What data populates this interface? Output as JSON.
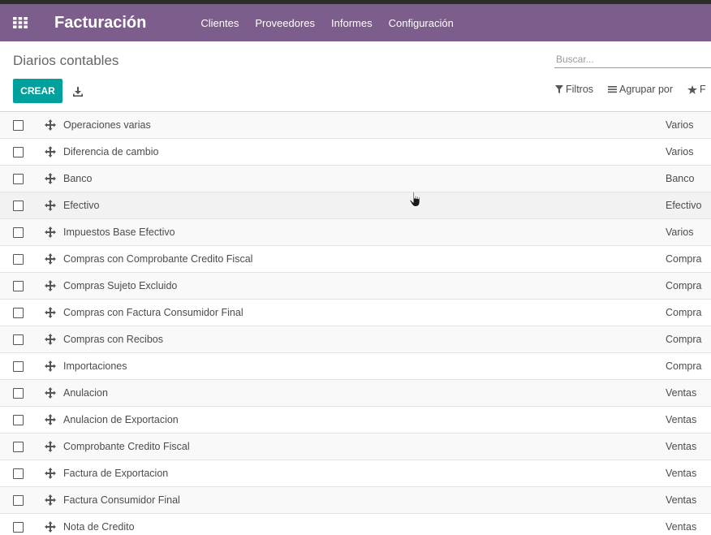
{
  "app": {
    "title": "Facturación",
    "menu": [
      "Clientes",
      "Proveedores",
      "Informes",
      "Configuración"
    ]
  },
  "control_panel": {
    "breadcrumb": "Diarios contables",
    "search_placeholder": "Buscar...",
    "create_label": "CREAR",
    "filters_label": "Filtros",
    "group_by_label": "Agrupar por",
    "favorites_label": "F"
  },
  "colors": {
    "navbar": "#7c5d8c",
    "primary_button": "#00a09d"
  },
  "journals": [
    {
      "name": "Operaciones varias",
      "type": "Varios"
    },
    {
      "name": "Diferencia de cambio",
      "type": "Varios"
    },
    {
      "name": "Banco",
      "type": "Banco"
    },
    {
      "name": "Efectivo",
      "type": "Efectivo"
    },
    {
      "name": "Impuestos Base Efectivo",
      "type": "Varios"
    },
    {
      "name": "Compras con Comprobante Credito Fiscal",
      "type": "Compra"
    },
    {
      "name": "Compras Sujeto Excluido",
      "type": "Compra"
    },
    {
      "name": "Compras con Factura Consumidor Final",
      "type": "Compra"
    },
    {
      "name": "Compras con Recibos",
      "type": "Compra"
    },
    {
      "name": "Importaciones",
      "type": "Compra"
    },
    {
      "name": "Anulacion",
      "type": "Ventas"
    },
    {
      "name": "Anulacion de Exportacion",
      "type": "Ventas"
    },
    {
      "name": "Comprobante Credito Fiscal",
      "type": "Ventas"
    },
    {
      "name": "Factura de Exportacion",
      "type": "Ventas"
    },
    {
      "name": "Factura Consumidor Final",
      "type": "Ventas"
    },
    {
      "name": "Nota de Credito",
      "type": "Ventas"
    }
  ]
}
